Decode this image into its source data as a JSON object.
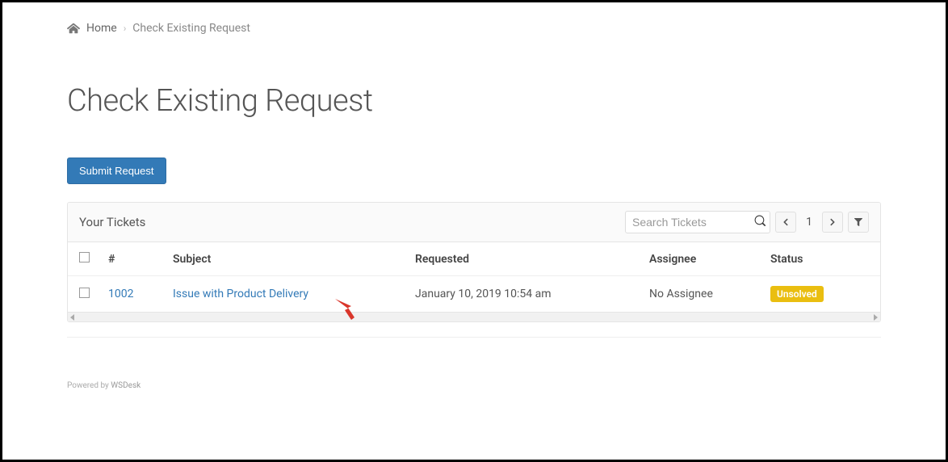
{
  "breadcrumb": {
    "home_label": "Home",
    "current_label": "Check Existing Request"
  },
  "page": {
    "title": "Check Existing Request"
  },
  "actions": {
    "submit_request_label": "Submit Request"
  },
  "panel": {
    "title": "Your Tickets",
    "search_placeholder": "Search Tickets",
    "page_number": "1"
  },
  "table": {
    "headers": {
      "id": "#",
      "subject": "Subject",
      "requested": "Requested",
      "assignee": "Assignee",
      "status": "Status"
    },
    "rows": [
      {
        "id": "1002",
        "subject": "Issue with Product Delivery",
        "requested": "January 10, 2019 10:54 am",
        "assignee": "No Assignee",
        "status": "Unsolved"
      }
    ]
  },
  "footer": {
    "powered_by": "Powered by",
    "brand": "WSDesk"
  }
}
